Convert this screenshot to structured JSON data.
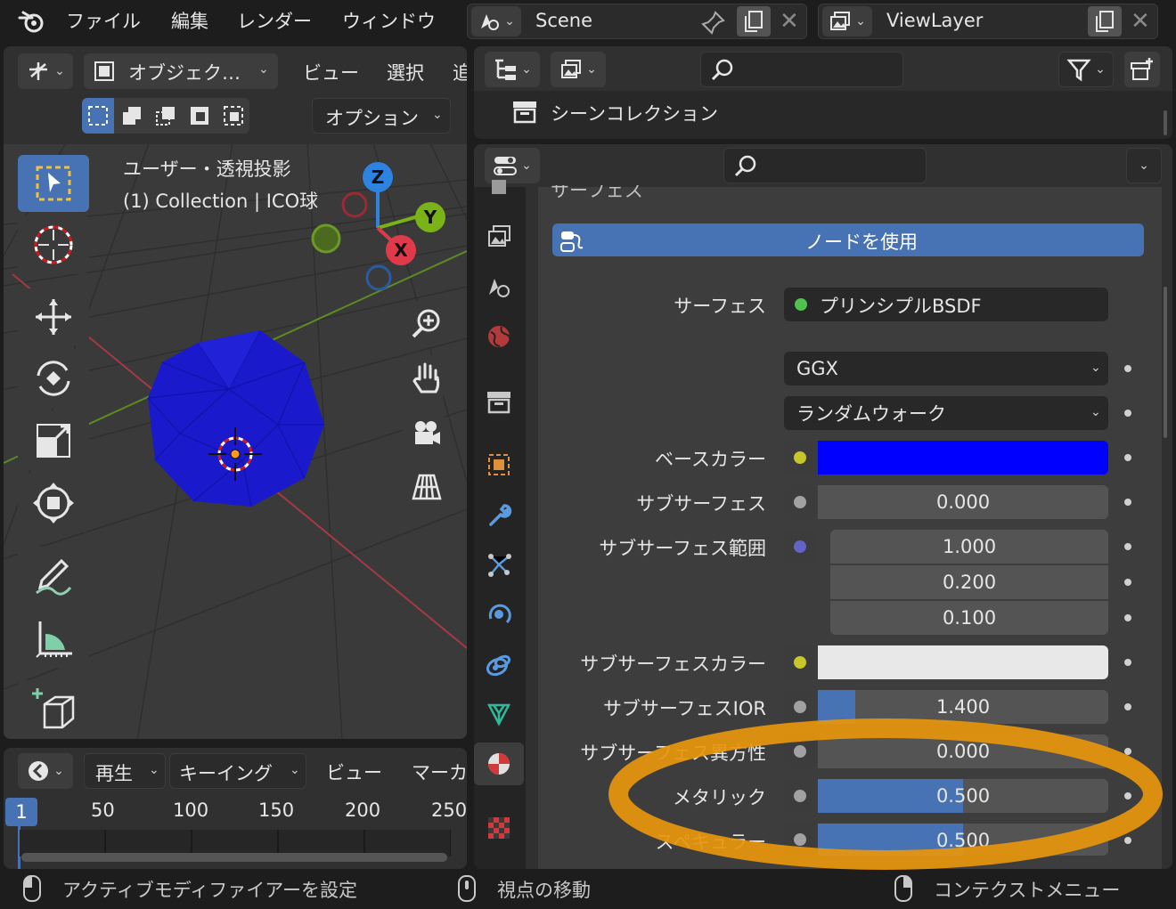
{
  "top_menu": [
    "ファイル",
    "編集",
    "レンダー",
    "ウィンドウ"
  ],
  "scene_name": "Scene",
  "view_layer_name": "ViewLayer",
  "viewport": {
    "header_menu": [
      "オブジェク…",
      "ビュー",
      "選択",
      "追"
    ],
    "options_label": "オプション",
    "view_title": "ユーザー・透視投影",
    "collection_info": "(1) Collection | ICO球",
    "gizmo": {
      "x": "X",
      "y": "Y",
      "z": "Z"
    }
  },
  "outliner": {
    "search_placeholder": "",
    "scene_collection": "シーンコレクション"
  },
  "timeline": {
    "menu": [
      "再生",
      "キーイング",
      "ビュー",
      "マーカ"
    ],
    "current_frame": "1",
    "ticks": [
      "50",
      "100",
      "150",
      "200",
      "250"
    ]
  },
  "properties": {
    "partial_header": "サーフェス",
    "use_nodes_label": "ノードを使用",
    "surface_label": "サーフェス",
    "surface_value": "プリンシプルBSDF",
    "distribution": "GGX",
    "subsurface_method": "ランダムウォーク",
    "base_color_label": "ベースカラー",
    "base_color": "#0000ff",
    "subsurface_label": "サブサーフェス",
    "subsurface_value": "0.000",
    "subsurface_radius_label": "サブサーフェス範囲",
    "subsurface_radius": [
      "1.000",
      "0.200",
      "0.100"
    ],
    "subsurface_color_label": "サブサーフェスカラー",
    "subsurface_color": "#e8e8e8",
    "subsurface_ior_label": "サブサーフェスIOR",
    "subsurface_ior_value": "1.400",
    "subsurface_anisotropy_label": "サブサーフェス異方性",
    "subsurface_anisotropy_value": "0.000",
    "metallic_label": "メタリック",
    "metallic_value": "0.500",
    "specular_label": "スペキュラー",
    "specular_value": "0.500"
  },
  "status_bar": {
    "left": "アクティブモディファイアーを設定",
    "middle": "視点の移動",
    "right": "コンテクストメニュー"
  },
  "colors": {
    "accent": "#4772b3",
    "highlight_ellipse": "#e8960c",
    "socket_yellow": "#c7c729",
    "socket_gray": "#a1a1a1",
    "socket_purple": "#6363c7",
    "socket_green": "#4fc24f"
  }
}
